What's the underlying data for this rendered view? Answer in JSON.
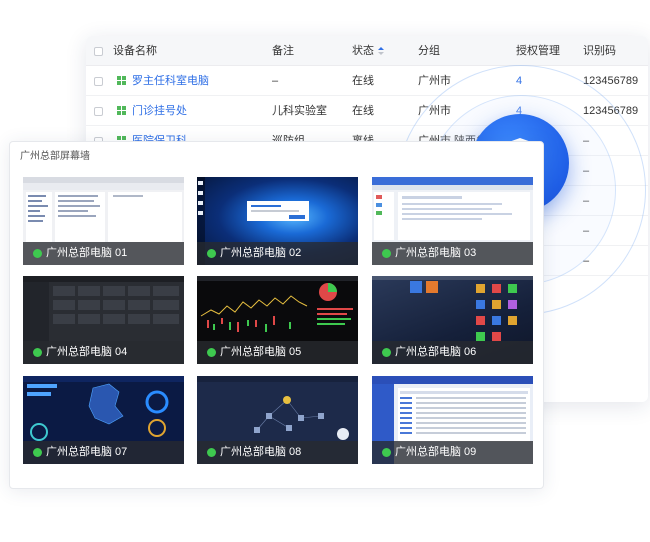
{
  "table": {
    "columns": [
      "设备名称",
      "备注",
      "状态",
      "分组",
      "授权管理",
      "识别码"
    ],
    "rows": [
      {
        "name": "罗主任科室电脑",
        "note": "–",
        "status": "在线",
        "group": "广州市",
        "auth": "4",
        "code": "123456789"
      },
      {
        "name": "门诊挂号处",
        "note": "儿科实验室",
        "status": "在线",
        "group": "广州市",
        "auth": "4",
        "code": "123456789"
      },
      {
        "name": "医院保卫科",
        "note": "巡防组",
        "status": "离线",
        "group": "广州市 陕西省",
        "auth": "",
        "code": "–"
      }
    ],
    "extra_dashes": [
      "–",
      "–",
      "–",
      "–"
    ]
  },
  "panel": {
    "title": "广州总部屏幕墙",
    "screens": [
      {
        "label": "广州总部电脑 01",
        "theme": "explorer"
      },
      {
        "label": "广州总部电脑 02",
        "theme": "win10"
      },
      {
        "label": "广州总部电脑 03",
        "theme": "web"
      },
      {
        "label": "广州总部电脑 04",
        "theme": "dark"
      },
      {
        "label": "广州总部电脑 05",
        "theme": "stock"
      },
      {
        "label": "广州总部电脑 06",
        "theme": "mac"
      },
      {
        "label": "广州总部电脑 07",
        "theme": "dashboard"
      },
      {
        "label": "广州总部电脑 08",
        "theme": "topology"
      },
      {
        "label": "广州总部电脑 09",
        "theme": "table"
      }
    ],
    "online_color": "#3ec94f"
  },
  "colors": {
    "accent": "#2f6fe6",
    "shield": "#1f5ee6",
    "windows_icon": "#51b85a"
  },
  "icons": {
    "shield": "shield-check-icon",
    "device": "windows-icon"
  }
}
